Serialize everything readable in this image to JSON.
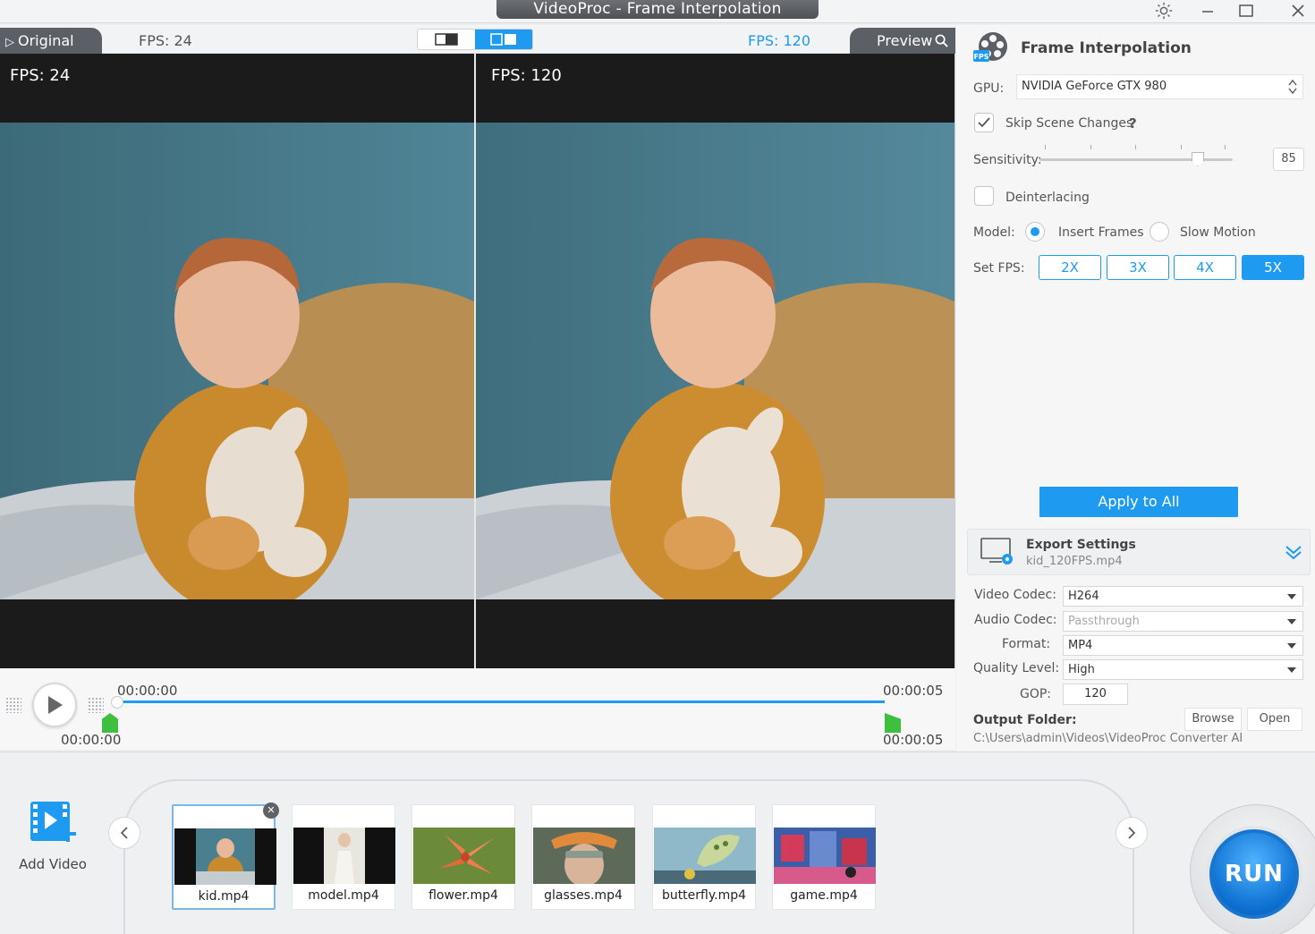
{
  "window": {
    "title": "VideoProc - Frame Interpolation",
    "settings_icon": "gear-icon",
    "minimize_icon": "minimize-icon",
    "maximize_icon": "maximize-icon",
    "close_icon": "close-icon"
  },
  "viewer": {
    "original_tab": "Original",
    "original_fps": "FPS: 24",
    "preview_fps": "FPS: 120",
    "preview_tab": "Preview",
    "left_label": "FPS: 24",
    "right_label": "FPS: 120"
  },
  "timeline": {
    "start_top": "00:00:00",
    "end_top": "00:00:05",
    "start_bottom": "00:00:00",
    "end_bottom": "00:00:05"
  },
  "panel": {
    "title": "Frame Interpolation",
    "gpu_label": "GPU:",
    "gpu_value": "NVIDIA GeForce GTX 980",
    "skip_scene_label": "Skip Scene Changes",
    "skip_scene_checked": true,
    "help": "?",
    "sensitivity_label": "Sensitivity:",
    "sensitivity_value": "85",
    "deinterlacing_label": "Deinterlacing",
    "deinterlacing_checked": false,
    "model_label": "Model:",
    "model_insert": "Insert Frames",
    "model_slow": "Slow Motion",
    "model_selected": "Insert Frames",
    "setfps_label": "Set FPS:",
    "fps_options": [
      "2X",
      "3X",
      "4X",
      "5X"
    ],
    "fps_selected": "5X",
    "apply_label": "Apply to All"
  },
  "export": {
    "title": "Export Settings",
    "filename": "kid_120FPS.mp4",
    "video_codec_label": "Video Codec:",
    "video_codec": "H264",
    "audio_codec_label": "Audio Codec:",
    "audio_codec": "Passthrough",
    "format_label": "Format:",
    "format": "MP4",
    "quality_label": "Quality Level:",
    "quality": "High",
    "gop_label": "GOP:",
    "gop": "120",
    "output_label": "Output Folder:",
    "browse": "Browse",
    "open": "Open",
    "path": "C:\\Users\\admin\\Videos\\VideoProc Converter AI"
  },
  "library": {
    "add_label": "Add Video",
    "files": [
      "kid.mp4",
      "model.mp4",
      "flower.mp4",
      "glasses.mp4",
      "butterfly.mp4",
      "game.mp4"
    ],
    "selected": "kid.mp4"
  },
  "run_label": "RUN",
  "colors": {
    "accent": "#1e9bf0",
    "handle": "#3fbf3f",
    "dark_tab": "#5b6066"
  }
}
